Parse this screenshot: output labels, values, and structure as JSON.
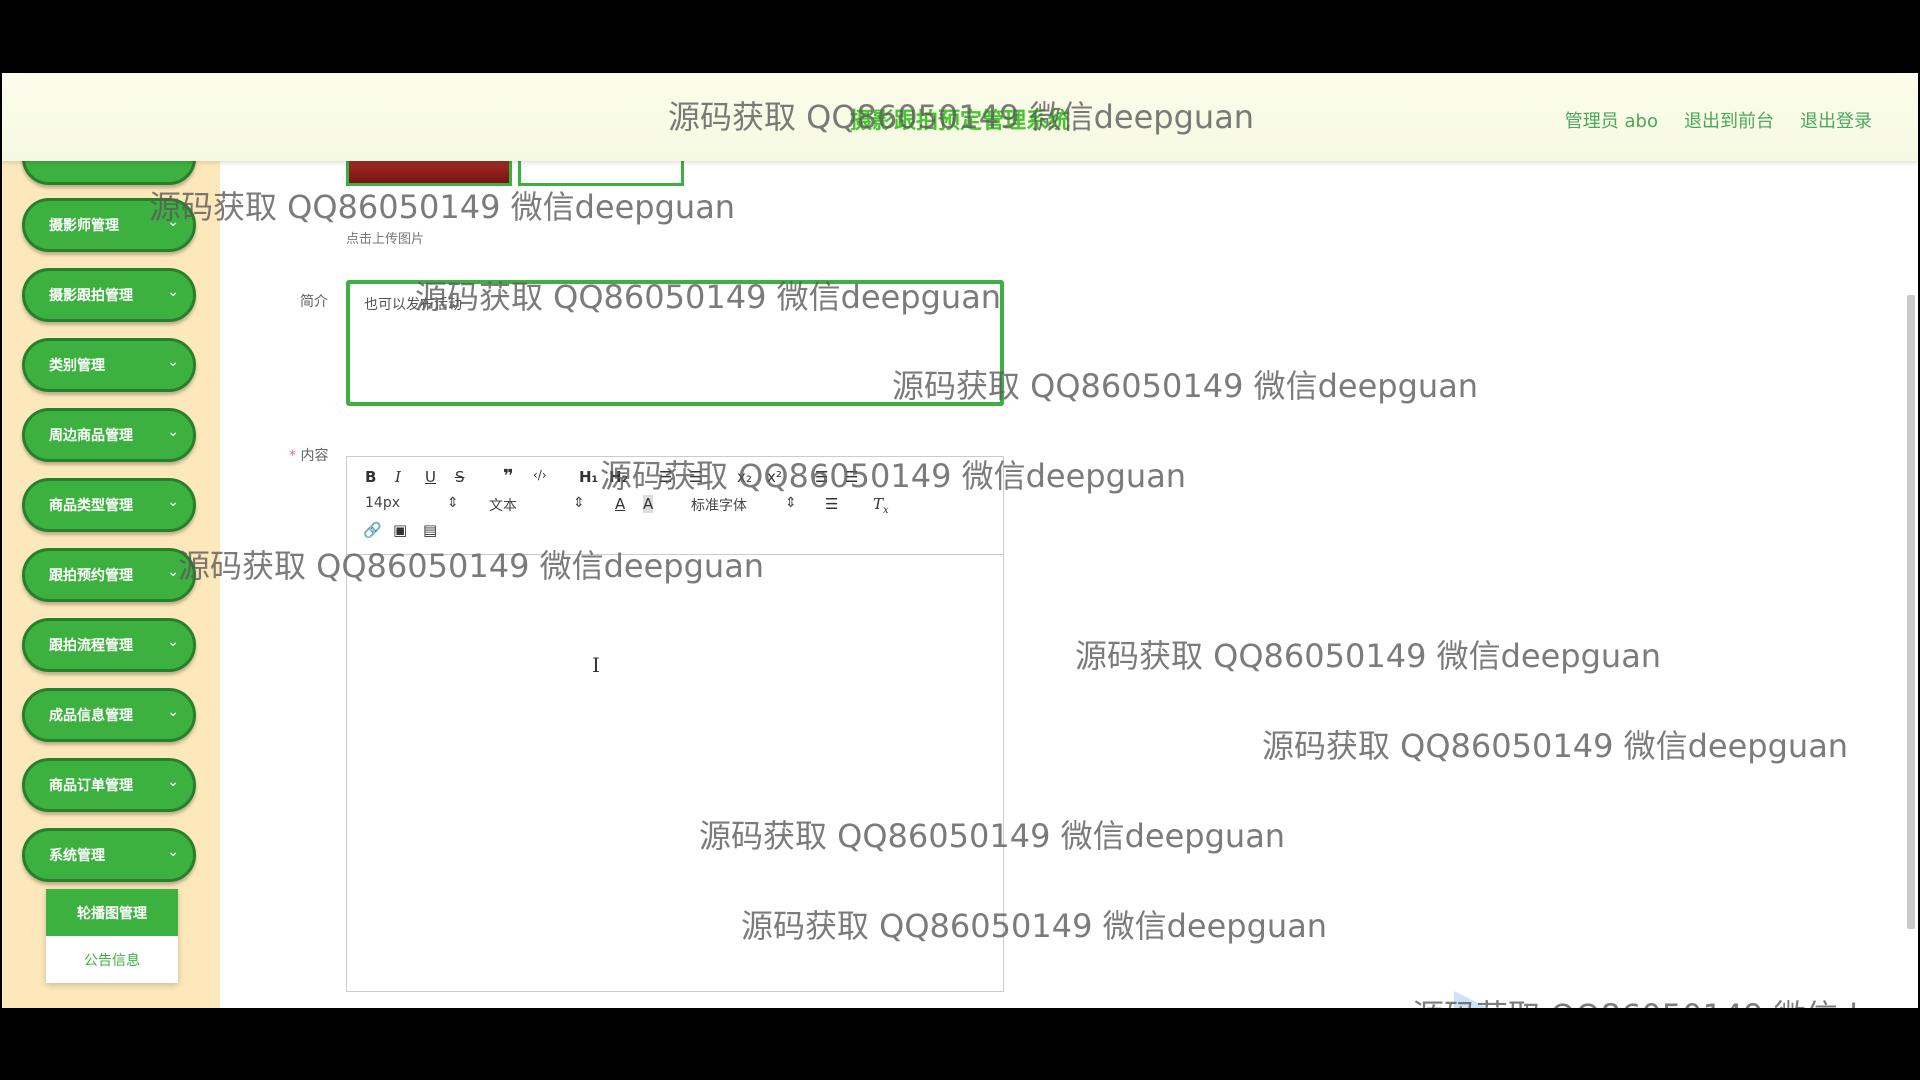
{
  "header": {
    "title": "摄影跟拍预定管理系统",
    "admin_label": "管理员 abo",
    "back_front": "退出到前台",
    "logout": "退出登录"
  },
  "sidebar": {
    "items": [
      {
        "label": "摄影师管理"
      },
      {
        "label": "摄影跟拍管理"
      },
      {
        "label": "类别管理"
      },
      {
        "label": "周边商品管理"
      },
      {
        "label": "商品类型管理"
      },
      {
        "label": "跟拍预约管理"
      },
      {
        "label": "跟拍流程管理"
      },
      {
        "label": "成品信息管理"
      },
      {
        "label": "商品订单管理"
      },
      {
        "label": "系统管理"
      }
    ],
    "chevron": "⌄",
    "submenu": [
      {
        "label": "轮播图管理",
        "active": true
      },
      {
        "label": "公告信息",
        "active": false
      }
    ]
  },
  "form": {
    "upload_tip": "点击上传图片",
    "intro_label": "简介",
    "intro_value": "也可以发布活动",
    "content_label": "内容",
    "required_mark": "*"
  },
  "editor": {
    "font_size": "14px",
    "header_select": "文本",
    "font_family": "标准字体",
    "icons": [
      "bold-icon",
      "italic-icon",
      "underline-icon",
      "strike-icon",
      "blockquote-icon",
      "code-block-icon",
      "h1-icon",
      "h2-icon",
      "ordered-list-icon",
      "bullet-list-icon",
      "subscript-icon",
      "superscript-icon",
      "outdent-icon",
      "indent-icon",
      "color-icon",
      "background-icon",
      "align-icon",
      "clean-icon",
      "link-icon",
      "image-icon",
      "video-icon"
    ]
  },
  "watermark": "源码获取 QQ86050149 微信deepguan"
}
